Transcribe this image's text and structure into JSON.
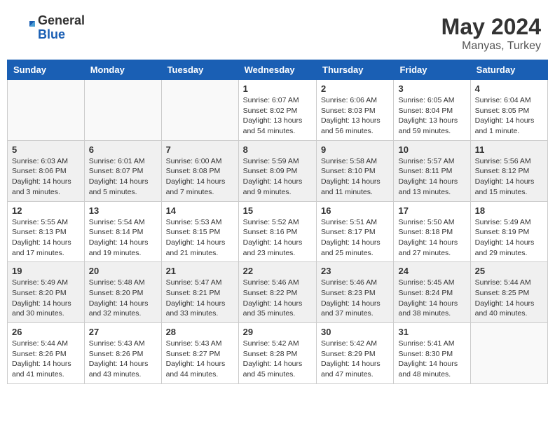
{
  "header": {
    "logo_general": "General",
    "logo_blue": "Blue",
    "month_year": "May 2024",
    "location": "Manyas, Turkey"
  },
  "weekdays": [
    "Sunday",
    "Monday",
    "Tuesday",
    "Wednesday",
    "Thursday",
    "Friday",
    "Saturday"
  ],
  "weeks": [
    [
      {
        "day": "",
        "empty": true
      },
      {
        "day": "",
        "empty": true
      },
      {
        "day": "",
        "empty": true
      },
      {
        "day": "1",
        "sunrise": "Sunrise: 6:07 AM",
        "sunset": "Sunset: 8:02 PM",
        "daylight": "Daylight: 13 hours and 54 minutes."
      },
      {
        "day": "2",
        "sunrise": "Sunrise: 6:06 AM",
        "sunset": "Sunset: 8:03 PM",
        "daylight": "Daylight: 13 hours and 56 minutes."
      },
      {
        "day": "3",
        "sunrise": "Sunrise: 6:05 AM",
        "sunset": "Sunset: 8:04 PM",
        "daylight": "Daylight: 13 hours and 59 minutes."
      },
      {
        "day": "4",
        "sunrise": "Sunrise: 6:04 AM",
        "sunset": "Sunset: 8:05 PM",
        "daylight": "Daylight: 14 hours and 1 minute."
      }
    ],
    [
      {
        "day": "5",
        "sunrise": "Sunrise: 6:03 AM",
        "sunset": "Sunset: 8:06 PM",
        "daylight": "Daylight: 14 hours and 3 minutes."
      },
      {
        "day": "6",
        "sunrise": "Sunrise: 6:01 AM",
        "sunset": "Sunset: 8:07 PM",
        "daylight": "Daylight: 14 hours and 5 minutes."
      },
      {
        "day": "7",
        "sunrise": "Sunrise: 6:00 AM",
        "sunset": "Sunset: 8:08 PM",
        "daylight": "Daylight: 14 hours and 7 minutes."
      },
      {
        "day": "8",
        "sunrise": "Sunrise: 5:59 AM",
        "sunset": "Sunset: 8:09 PM",
        "daylight": "Daylight: 14 hours and 9 minutes."
      },
      {
        "day": "9",
        "sunrise": "Sunrise: 5:58 AM",
        "sunset": "Sunset: 8:10 PM",
        "daylight": "Daylight: 14 hours and 11 minutes."
      },
      {
        "day": "10",
        "sunrise": "Sunrise: 5:57 AM",
        "sunset": "Sunset: 8:11 PM",
        "daylight": "Daylight: 14 hours and 13 minutes."
      },
      {
        "day": "11",
        "sunrise": "Sunrise: 5:56 AM",
        "sunset": "Sunset: 8:12 PM",
        "daylight": "Daylight: 14 hours and 15 minutes."
      }
    ],
    [
      {
        "day": "12",
        "sunrise": "Sunrise: 5:55 AM",
        "sunset": "Sunset: 8:13 PM",
        "daylight": "Daylight: 14 hours and 17 minutes."
      },
      {
        "day": "13",
        "sunrise": "Sunrise: 5:54 AM",
        "sunset": "Sunset: 8:14 PM",
        "daylight": "Daylight: 14 hours and 19 minutes."
      },
      {
        "day": "14",
        "sunrise": "Sunrise: 5:53 AM",
        "sunset": "Sunset: 8:15 PM",
        "daylight": "Daylight: 14 hours and 21 minutes."
      },
      {
        "day": "15",
        "sunrise": "Sunrise: 5:52 AM",
        "sunset": "Sunset: 8:16 PM",
        "daylight": "Daylight: 14 hours and 23 minutes."
      },
      {
        "day": "16",
        "sunrise": "Sunrise: 5:51 AM",
        "sunset": "Sunset: 8:17 PM",
        "daylight": "Daylight: 14 hours and 25 minutes."
      },
      {
        "day": "17",
        "sunrise": "Sunrise: 5:50 AM",
        "sunset": "Sunset: 8:18 PM",
        "daylight": "Daylight: 14 hours and 27 minutes."
      },
      {
        "day": "18",
        "sunrise": "Sunrise: 5:49 AM",
        "sunset": "Sunset: 8:19 PM",
        "daylight": "Daylight: 14 hours and 29 minutes."
      }
    ],
    [
      {
        "day": "19",
        "sunrise": "Sunrise: 5:49 AM",
        "sunset": "Sunset: 8:20 PM",
        "daylight": "Daylight: 14 hours and 30 minutes."
      },
      {
        "day": "20",
        "sunrise": "Sunrise: 5:48 AM",
        "sunset": "Sunset: 8:20 PM",
        "daylight": "Daylight: 14 hours and 32 minutes."
      },
      {
        "day": "21",
        "sunrise": "Sunrise: 5:47 AM",
        "sunset": "Sunset: 8:21 PM",
        "daylight": "Daylight: 14 hours and 33 minutes."
      },
      {
        "day": "22",
        "sunrise": "Sunrise: 5:46 AM",
        "sunset": "Sunset: 8:22 PM",
        "daylight": "Daylight: 14 hours and 35 minutes."
      },
      {
        "day": "23",
        "sunrise": "Sunrise: 5:46 AM",
        "sunset": "Sunset: 8:23 PM",
        "daylight": "Daylight: 14 hours and 37 minutes."
      },
      {
        "day": "24",
        "sunrise": "Sunrise: 5:45 AM",
        "sunset": "Sunset: 8:24 PM",
        "daylight": "Daylight: 14 hours and 38 minutes."
      },
      {
        "day": "25",
        "sunrise": "Sunrise: 5:44 AM",
        "sunset": "Sunset: 8:25 PM",
        "daylight": "Daylight: 14 hours and 40 minutes."
      }
    ],
    [
      {
        "day": "26",
        "sunrise": "Sunrise: 5:44 AM",
        "sunset": "Sunset: 8:26 PM",
        "daylight": "Daylight: 14 hours and 41 minutes."
      },
      {
        "day": "27",
        "sunrise": "Sunrise: 5:43 AM",
        "sunset": "Sunset: 8:26 PM",
        "daylight": "Daylight: 14 hours and 43 minutes."
      },
      {
        "day": "28",
        "sunrise": "Sunrise: 5:43 AM",
        "sunset": "Sunset: 8:27 PM",
        "daylight": "Daylight: 14 hours and 44 minutes."
      },
      {
        "day": "29",
        "sunrise": "Sunrise: 5:42 AM",
        "sunset": "Sunset: 8:28 PM",
        "daylight": "Daylight: 14 hours and 45 minutes."
      },
      {
        "day": "30",
        "sunrise": "Sunrise: 5:42 AM",
        "sunset": "Sunset: 8:29 PM",
        "daylight": "Daylight: 14 hours and 47 minutes."
      },
      {
        "day": "31",
        "sunrise": "Sunrise: 5:41 AM",
        "sunset": "Sunset: 8:30 PM",
        "daylight": "Daylight: 14 hours and 48 minutes."
      },
      {
        "day": "",
        "empty": true
      }
    ]
  ]
}
